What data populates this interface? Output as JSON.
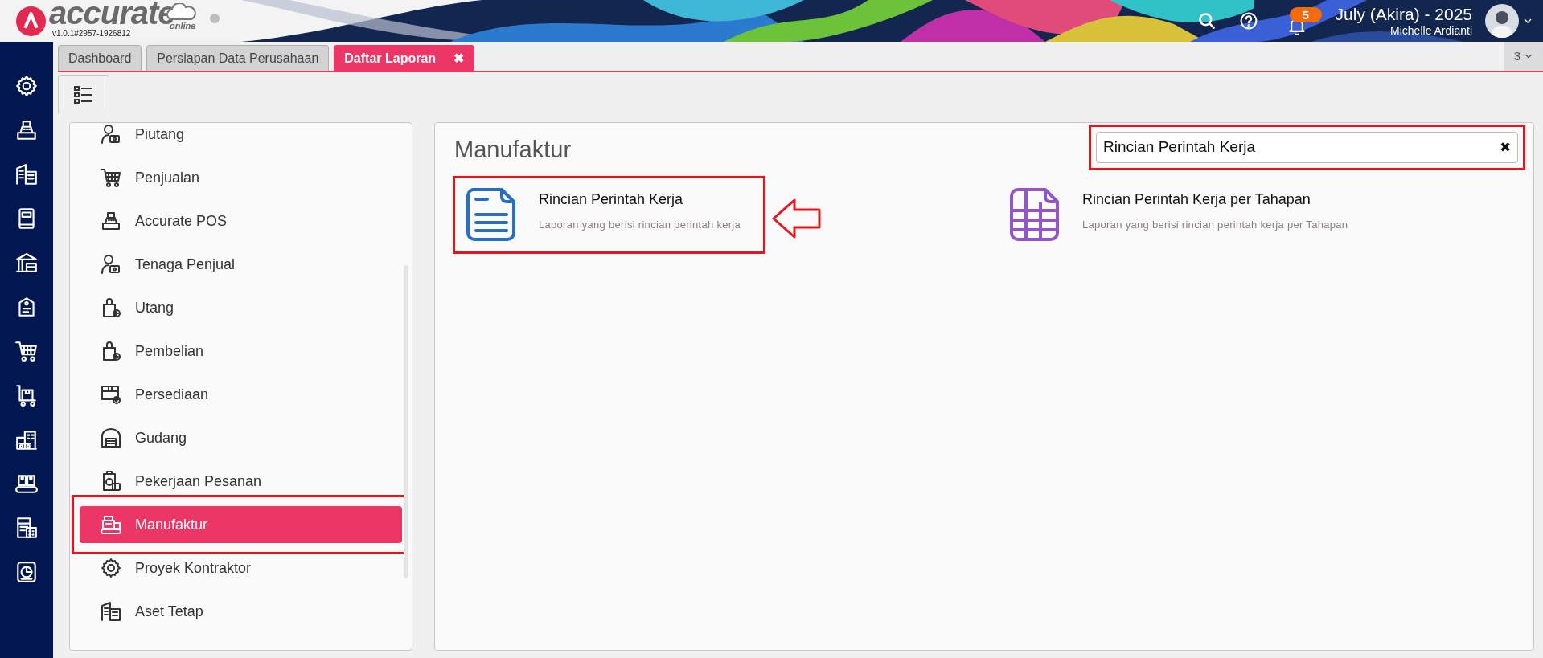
{
  "header": {
    "brand": "accurate",
    "brand_sub": "online",
    "version": "v1.0.1#2957-1926812",
    "notification_count": "5",
    "period": "July (Akira) - 2025",
    "user": "Michelle Ardianti"
  },
  "nav_icons": [
    {
      "kind": "gear"
    },
    {
      "kind": "register"
    },
    {
      "kind": "building"
    },
    {
      "kind": "book"
    },
    {
      "kind": "bank"
    },
    {
      "kind": "tag"
    },
    {
      "kind": "cart"
    },
    {
      "kind": "trolley"
    },
    {
      "kind": "city"
    },
    {
      "kind": "conveyor"
    },
    {
      "kind": "tax"
    },
    {
      "kind": "chart"
    }
  ],
  "tabs": [
    {
      "label": "Dashboard",
      "selected": false
    },
    {
      "label": "Persiapan Data Perusahaan",
      "selected": false
    },
    {
      "label": "Daftar Laporan",
      "selected": true,
      "close": "✖"
    }
  ],
  "tab_count": "3",
  "categories": [
    {
      "label": "Piutang",
      "selected": false,
      "annotated": false,
      "kind": "person"
    },
    {
      "label": "Penjualan",
      "selected": false,
      "annotated": false,
      "kind": "cart"
    },
    {
      "label": "Accurate POS",
      "selected": false,
      "annotated": false,
      "kind": "register"
    },
    {
      "label": "Tenaga Penjual",
      "selected": false,
      "annotated": false,
      "kind": "person"
    },
    {
      "label": "Utang",
      "selected": false,
      "annotated": false,
      "kind": "bag"
    },
    {
      "label": "Pembelian",
      "selected": false,
      "annotated": false,
      "kind": "bag"
    },
    {
      "label": "Persediaan",
      "selected": false,
      "annotated": false,
      "kind": "box"
    },
    {
      "label": "Gudang",
      "selected": false,
      "annotated": false,
      "kind": "warehouse"
    },
    {
      "label": "Pekerjaan Pesanan",
      "selected": false,
      "annotated": false,
      "kind": "clipboard"
    },
    {
      "label": "Manufaktur",
      "selected": true,
      "annotated": true,
      "kind": "factory"
    },
    {
      "label": "Proyek Kontraktor",
      "selected": false,
      "annotated": false,
      "kind": "gear"
    },
    {
      "label": "Aset Tetap",
      "selected": false,
      "annotated": false,
      "kind": "building"
    }
  ],
  "section": {
    "title": "Manufaktur",
    "search": {
      "value": "Rincian Perintah Kerja",
      "clear": "✖",
      "annotated": true
    },
    "reports": [
      {
        "title": "Rincian Perintah Kerja",
        "description": "Laporan yang berisi rincian perintah kerja",
        "kind": "document",
        "annotated": true
      },
      {
        "title": "Rincian Perintah Kerja per Tahapan",
        "description": "Laporan yang berisi rincian perintah kerja per Tahapan",
        "kind": "grid",
        "annotated": false
      }
    ]
  }
}
